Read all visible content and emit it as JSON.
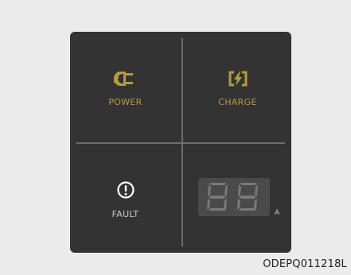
{
  "panel": {
    "power": {
      "label": "POWER",
      "icon": "plug-icon",
      "color": "#b79a3f"
    },
    "charge": {
      "label": "CHARGE",
      "icon": "charging-bolt-icon",
      "color": "#b79a3f"
    },
    "fault": {
      "label": "FAULT",
      "icon": "alert-circle-icon"
    },
    "display": {
      "digits": "88",
      "unit": "A"
    }
  },
  "caption": "ODEPQ011218L",
  "colors": {
    "background": "#ebebeb",
    "panel": "#333333",
    "divider": "#6d6d6d",
    "amber": "#b79a3f",
    "segment_off": "#7a7a7a"
  }
}
